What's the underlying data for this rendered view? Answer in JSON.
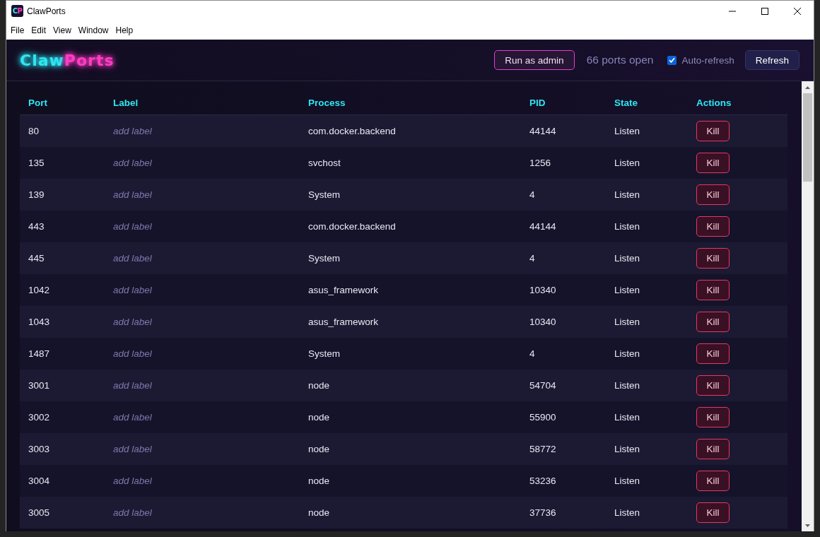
{
  "window": {
    "title": "ClawPorts",
    "icon": {
      "parts": [
        {
          "text": "C",
          "color": "#2ee6f2"
        },
        {
          "text": "P",
          "color": "#ff3cc4"
        }
      ]
    }
  },
  "menu": [
    "File",
    "Edit",
    "View",
    "Window",
    "Help"
  ],
  "header": {
    "logo": {
      "parts": [
        {
          "text": "Claw",
          "color": "#2ee6f2"
        },
        {
          "text": "Ports",
          "color": "#ff3cc4"
        }
      ]
    },
    "admin_button": "Run as admin",
    "port_count": "66 ports open",
    "auto_refresh": {
      "label": "Auto-refresh",
      "checked": true
    },
    "refresh_button": "Refresh"
  },
  "table": {
    "columns": [
      "Port",
      "Label",
      "Process",
      "PID",
      "State",
      "Actions"
    ],
    "rows": [
      {
        "port": "80",
        "label": {
          "placeholder": "add label"
        },
        "process": "com.docker.backend",
        "pid": "44144",
        "state": "Listen",
        "action": "Kill"
      },
      {
        "port": "135",
        "label": {
          "placeholder": "add label"
        },
        "process": "svchost",
        "pid": "1256",
        "state": "Listen",
        "action": "Kill"
      },
      {
        "port": "139",
        "label": {
          "placeholder": "add label"
        },
        "process": "System",
        "pid": "4",
        "state": "Listen",
        "action": "Kill"
      },
      {
        "port": "443",
        "label": {
          "placeholder": "add label"
        },
        "process": "com.docker.backend",
        "pid": "44144",
        "state": "Listen",
        "action": "Kill"
      },
      {
        "port": "445",
        "label": {
          "placeholder": "add label"
        },
        "process": "System",
        "pid": "4",
        "state": "Listen",
        "action": "Kill"
      },
      {
        "port": "1042",
        "label": {
          "placeholder": "add label"
        },
        "process": "asus_framework",
        "pid": "10340",
        "state": "Listen",
        "action": "Kill"
      },
      {
        "port": "1043",
        "label": {
          "placeholder": "add label"
        },
        "process": "asus_framework",
        "pid": "10340",
        "state": "Listen",
        "action": "Kill"
      },
      {
        "port": "1487",
        "label": {
          "placeholder": "add label"
        },
        "process": "System",
        "pid": "4",
        "state": "Listen",
        "action": "Kill"
      },
      {
        "port": "3001",
        "label": {
          "placeholder": "add label"
        },
        "process": "node",
        "pid": "54704",
        "state": "Listen",
        "action": "Kill"
      },
      {
        "port": "3002",
        "label": {
          "placeholder": "add label"
        },
        "process": "node",
        "pid": "55900",
        "state": "Listen",
        "action": "Kill"
      },
      {
        "port": "3003",
        "label": {
          "placeholder": "add label"
        },
        "process": "node",
        "pid": "58772",
        "state": "Listen",
        "action": "Kill"
      },
      {
        "port": "3004",
        "label": {
          "placeholder": "add label"
        },
        "process": "node",
        "pid": "53236",
        "state": "Listen",
        "action": "Kill"
      },
      {
        "port": "3005",
        "label": {
          "placeholder": "add label"
        },
        "process": "node",
        "pid": "37736",
        "state": "Listen",
        "action": "Kill"
      }
    ]
  }
}
